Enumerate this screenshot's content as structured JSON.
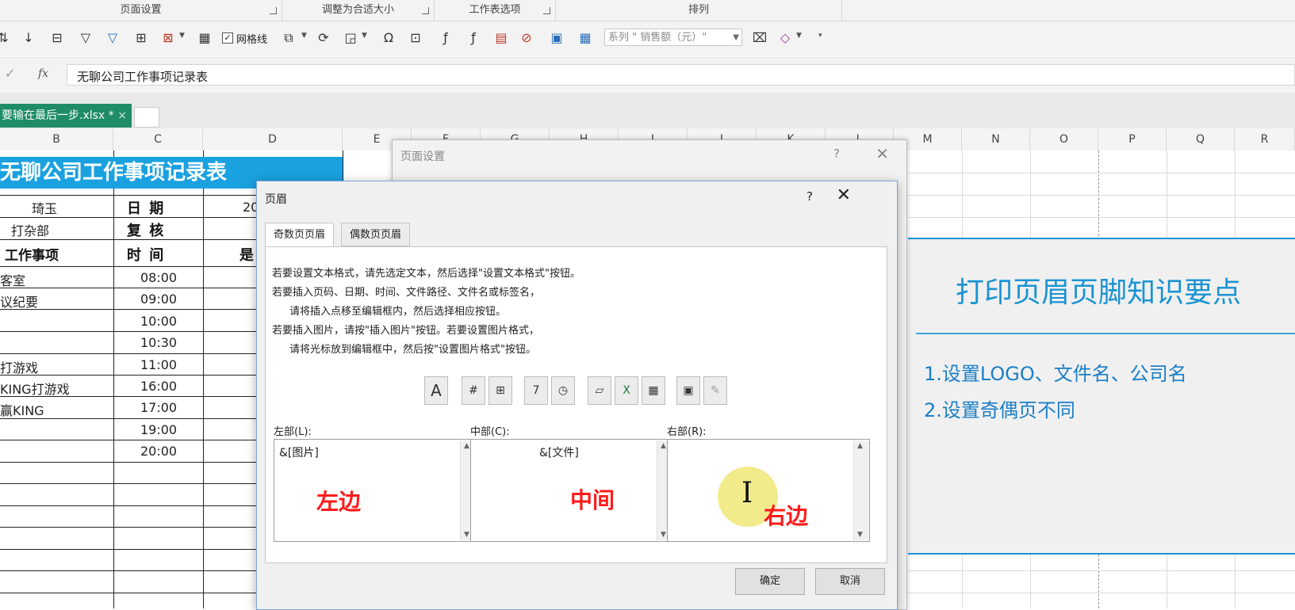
{
  "ribbon": {
    "groups": [
      {
        "label": "页面设置"
      },
      {
        "label": "调整为合适大小"
      },
      {
        "label": "工作表选项"
      },
      {
        "label": "排列"
      }
    ],
    "gridlines_label": "网格线",
    "series_selector": "系列 \" 销售额（元）\""
  },
  "formula_bar": {
    "fx": "fx",
    "value": "无聊公司工作事项记录表"
  },
  "file_tab": {
    "name": "要输在最后一步.xlsx *",
    "close": "×"
  },
  "columns": [
    "B",
    "C",
    "D",
    "E",
    "F",
    "G",
    "H",
    "I",
    "J",
    "K",
    "L",
    "M",
    "N",
    "O",
    "P",
    "Q",
    "R"
  ],
  "sheet": {
    "title": "无聊公司工作事项记录表",
    "rows": [
      {
        "b": "琦玉",
        "c": "日  期",
        "d": "20"
      },
      {
        "b": "打杂部",
        "c": "复  核",
        "d": ""
      },
      {
        "b": "工作事项",
        "c": "时  间",
        "d": "是"
      },
      {
        "b": "客室",
        "c": "08:00",
        "d": ""
      },
      {
        "b": "议纪要",
        "c": "09:00",
        "d": ""
      },
      {
        "b": "",
        "c": "10:00",
        "d": ""
      },
      {
        "b": "",
        "c": "10:30",
        "d": ""
      },
      {
        "b": "打游戏",
        "c": "11:00",
        "d": ""
      },
      {
        "b": "KING打游戏",
        "c": "16:00",
        "d": ""
      },
      {
        "b": "赢KING",
        "c": "17:00",
        "d": ""
      },
      {
        "b": "",
        "c": "19:00",
        "d": ""
      },
      {
        "b": "",
        "c": "20:00",
        "d": ""
      }
    ]
  },
  "page_setup_dialog": {
    "title": "页面设置",
    "help": "?",
    "close": "✕"
  },
  "header_dialog": {
    "title": "页眉",
    "help": "?",
    "close": "✕",
    "tabs": [
      "奇数页页眉",
      "偶数页页眉"
    ],
    "instructions": [
      "若要设置文本格式，请先选定文本，然后选择\"设置文本格式\"按钮。",
      "若要插入页码、日期、时间、文件路径、文件名或标签名，",
      "请将插入点移至编辑框内，然后选择相应按钮。",
      "若要插入图片，请按\"插入图片\"按钮。若要设置图片格式，",
      "请将光标放到编辑框中，然后按\"设置图片格式\"按钮。"
    ],
    "sections": {
      "left_label": "左部(L):",
      "center_label": "中部(C):",
      "right_label": "右部(R):",
      "left_value": "&[图片]",
      "center_value": "&[文件]",
      "right_value": ""
    },
    "ok": "确定",
    "cancel": "取消"
  },
  "annotations": {
    "left": "左边",
    "center": "中间",
    "right": "右边",
    "color": "#ff1a1a"
  },
  "slide": {
    "title": "打印页眉页脚知识要点",
    "points": [
      "1.设置LOGO、文件名、公司名",
      "2.设置奇偶页不同"
    ],
    "accent": "#1a93d2"
  }
}
